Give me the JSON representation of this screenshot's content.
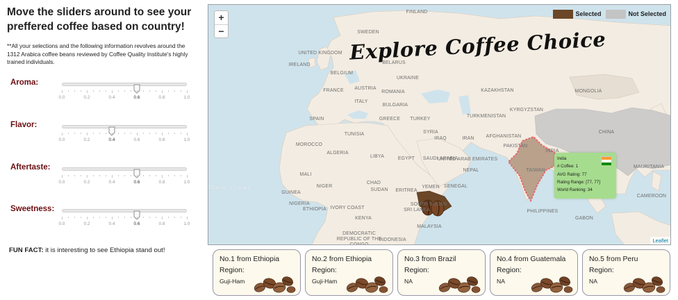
{
  "left_panel": {
    "headline": "Move the sliders around to see your preffered coffee based on country!",
    "note": "**All your selections and the following information revolves around the 1312 Arabica coffee beans reviewed by Coffee Quality Institute's highly trained individuals.",
    "sliders": [
      {
        "label": "Aroma:",
        "value": 0.6
      },
      {
        "label": "Flavor:",
        "value": 0.4
      },
      {
        "label": "Aftertaste:",
        "value": 0.6
      },
      {
        "label": "Sweetness:",
        "value": 0.6
      }
    ],
    "tick_labels": [
      "0.0",
      "0.2",
      "0.4",
      "0.6",
      "0.8",
      "1.0"
    ],
    "fun_fact_label": "FUN FACT:",
    "fun_fact_text": "it is interesting to see Ethiopia stand out!"
  },
  "map": {
    "title": "Explore Coffee Choice",
    "zoom_in": "+",
    "zoom_out": "−",
    "legend": [
      {
        "label": "Selected",
        "color": "#6b4727"
      },
      {
        "label": "Not Selected",
        "color": "#c4c4c4"
      }
    ],
    "attribution": "Leaflet",
    "ocean_label": "Atlantic Ocean",
    "country_labels": [
      "FINLAND",
      "SWEDEN",
      "UNITED KINGDOM",
      "IRELAND",
      "BELARUS",
      "BELGIUM",
      "UKRAINE",
      "FRANCE",
      "AUSTRIA",
      "ROMANIA",
      "KAZAKHSTAN",
      "MONGOLIA",
      "ITALY",
      "BULGARIA",
      "SPAIN",
      "GREECE",
      "TURKEY",
      "TURKMENISTAN",
      "KYRGYZSTAN",
      "TUNISIA",
      "SYRIA",
      "IRAQ",
      "IRAN",
      "AFGHANISTAN",
      "CHINA",
      "MOROCCO",
      "PAKISTAN",
      "ALGERIA",
      "LIBYA",
      "EGYPT",
      "SAUDI ARABIA",
      "UNITED ARAB EMIRATES",
      "NEPAL",
      "INDIA",
      "TAIWAN",
      "MAURITANIA",
      "MALI",
      "NIGER",
      "CHAD",
      "SUDAN",
      "ERITREA",
      "YEMEN",
      "SENEGAL",
      "GUINEA",
      "NIGERIA",
      "IVORY COAST",
      "ETHIOPIA",
      "SOUTH SUDAN",
      "SRI LANKA",
      "PHILIPPINES",
      "CAMEROON",
      "KENYA",
      "MALAYSIA",
      "GABON",
      "DEMOCRATIC REPUBLIC OF THE CONGO",
      "INDONESIA"
    ],
    "tooltip": {
      "country": "India",
      "coffee_count_label": "# Coffee:",
      "coffee_count": "1",
      "avg_rating_label": "AVG Rating:",
      "avg_rating": "77",
      "rating_range_label": "Rating Range:",
      "rating_range": "[77, 77]",
      "world_ranking_label": "World Ranking:",
      "world_ranking": "34",
      "flag_colors": [
        "#ff9933",
        "#ffffff",
        "#138808"
      ]
    }
  },
  "cards": [
    {
      "title": "No.1 from Ethiopia",
      "region_label": "Region:",
      "region": "Guji-Ham"
    },
    {
      "title": "No.2 from Ethiopia",
      "region_label": "Region:",
      "region": "Guji-Ham"
    },
    {
      "title": "No.3 from Brazil",
      "region_label": "Region:",
      "region": "NA"
    },
    {
      "title": "No.4 from Guatemala",
      "region_label": "Region:",
      "region": "NA"
    },
    {
      "title": "No.5 from Peru",
      "region_label": "Region:",
      "region": "NA"
    }
  ]
}
